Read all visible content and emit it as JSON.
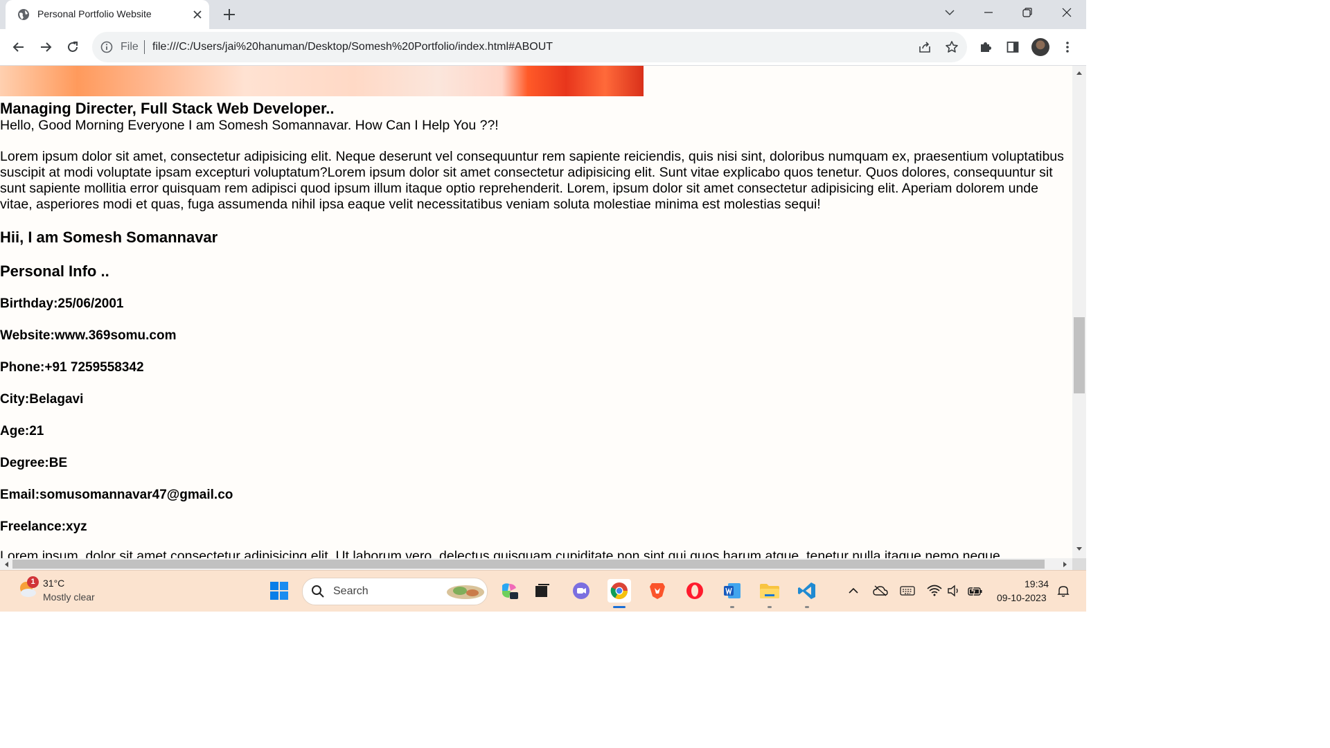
{
  "browser": {
    "tab_title": "Personal Portfolio Website",
    "omnibox_scheme_label": "File",
    "url": "file:///C:/Users/jai%20hanuman/Desktop/Somesh%20Portfolio/index.html#ABOUT"
  },
  "page": {
    "role": "Managing Directer, Full Stack Web Developer..",
    "greeting": "Hello, Good Morning Everyone I am Somesh Somannavar. How Can I Help You ??!",
    "lorem": "Lorem ipsum dolor sit amet, consectetur adipisicing elit. Neque deserunt vel consequuntur rem sapiente reiciendis, quis nisi sint, doloribus numquam ex, praesentium voluptatibus suscipit at modi voluptate ipsam excepturi voluptatum?Lorem ipsum dolor sit amet consectetur adipisicing elit. Sunt vitae explicabo quos tenetur. Quos dolores, consequuntur sit sunt sapiente mollitia error quisquam rem adipisci quod ipsum illum itaque optio reprehenderit. Lorem, ipsum dolor sit amet consectetur adipisicing elit. Aperiam dolorem unde vitae, asperiores modi et quas, fuga assumenda nihil ipsa eaque velit necessitatibus veniam soluta molestiae minima est molestias sequi!",
    "intro_heading": "Hii, I am Somesh Somannavar",
    "personal_info_heading": "Personal Info ..",
    "info": [
      "Birthday:25/06/2001",
      "Website:www.369somu.com",
      "Phone:+91 7259558342",
      "City:Belagavi",
      "Age:21",
      "Degree:BE",
      "Email:somusomannavar47@gmail.co",
      "Freelance:xyz"
    ],
    "lorem_cut": "Lorem ipsum, dolor sit amet consectetur adipisicing elit. Ut laborum vero, delectus quisquam cupiditate non sint qui quos harum atque, tenetur nulla itaque nemo neque"
  },
  "taskbar": {
    "weather_temp": "31°C",
    "weather_desc": "Mostly clear",
    "weather_badge": "1",
    "search_label": "Search",
    "clock_time": "19:34",
    "clock_date": "09-10-2023"
  },
  "icons": {
    "tab_favicon": "globe-icon",
    "back": "back-arrow-icon",
    "forward": "forward-arrow-icon",
    "reload": "reload-icon",
    "share": "share-icon",
    "bookmark": "star-icon",
    "extensions": "puzzle-icon",
    "side_panel": "side-panel-icon",
    "menu": "kebab-menu-icon"
  },
  "colors": {
    "tabstrip_bg": "#dee1e6",
    "omnibox_bg": "#f1f3f4",
    "taskbar_bg": "#fbe3cf",
    "page_bg": "#fffdfa"
  }
}
